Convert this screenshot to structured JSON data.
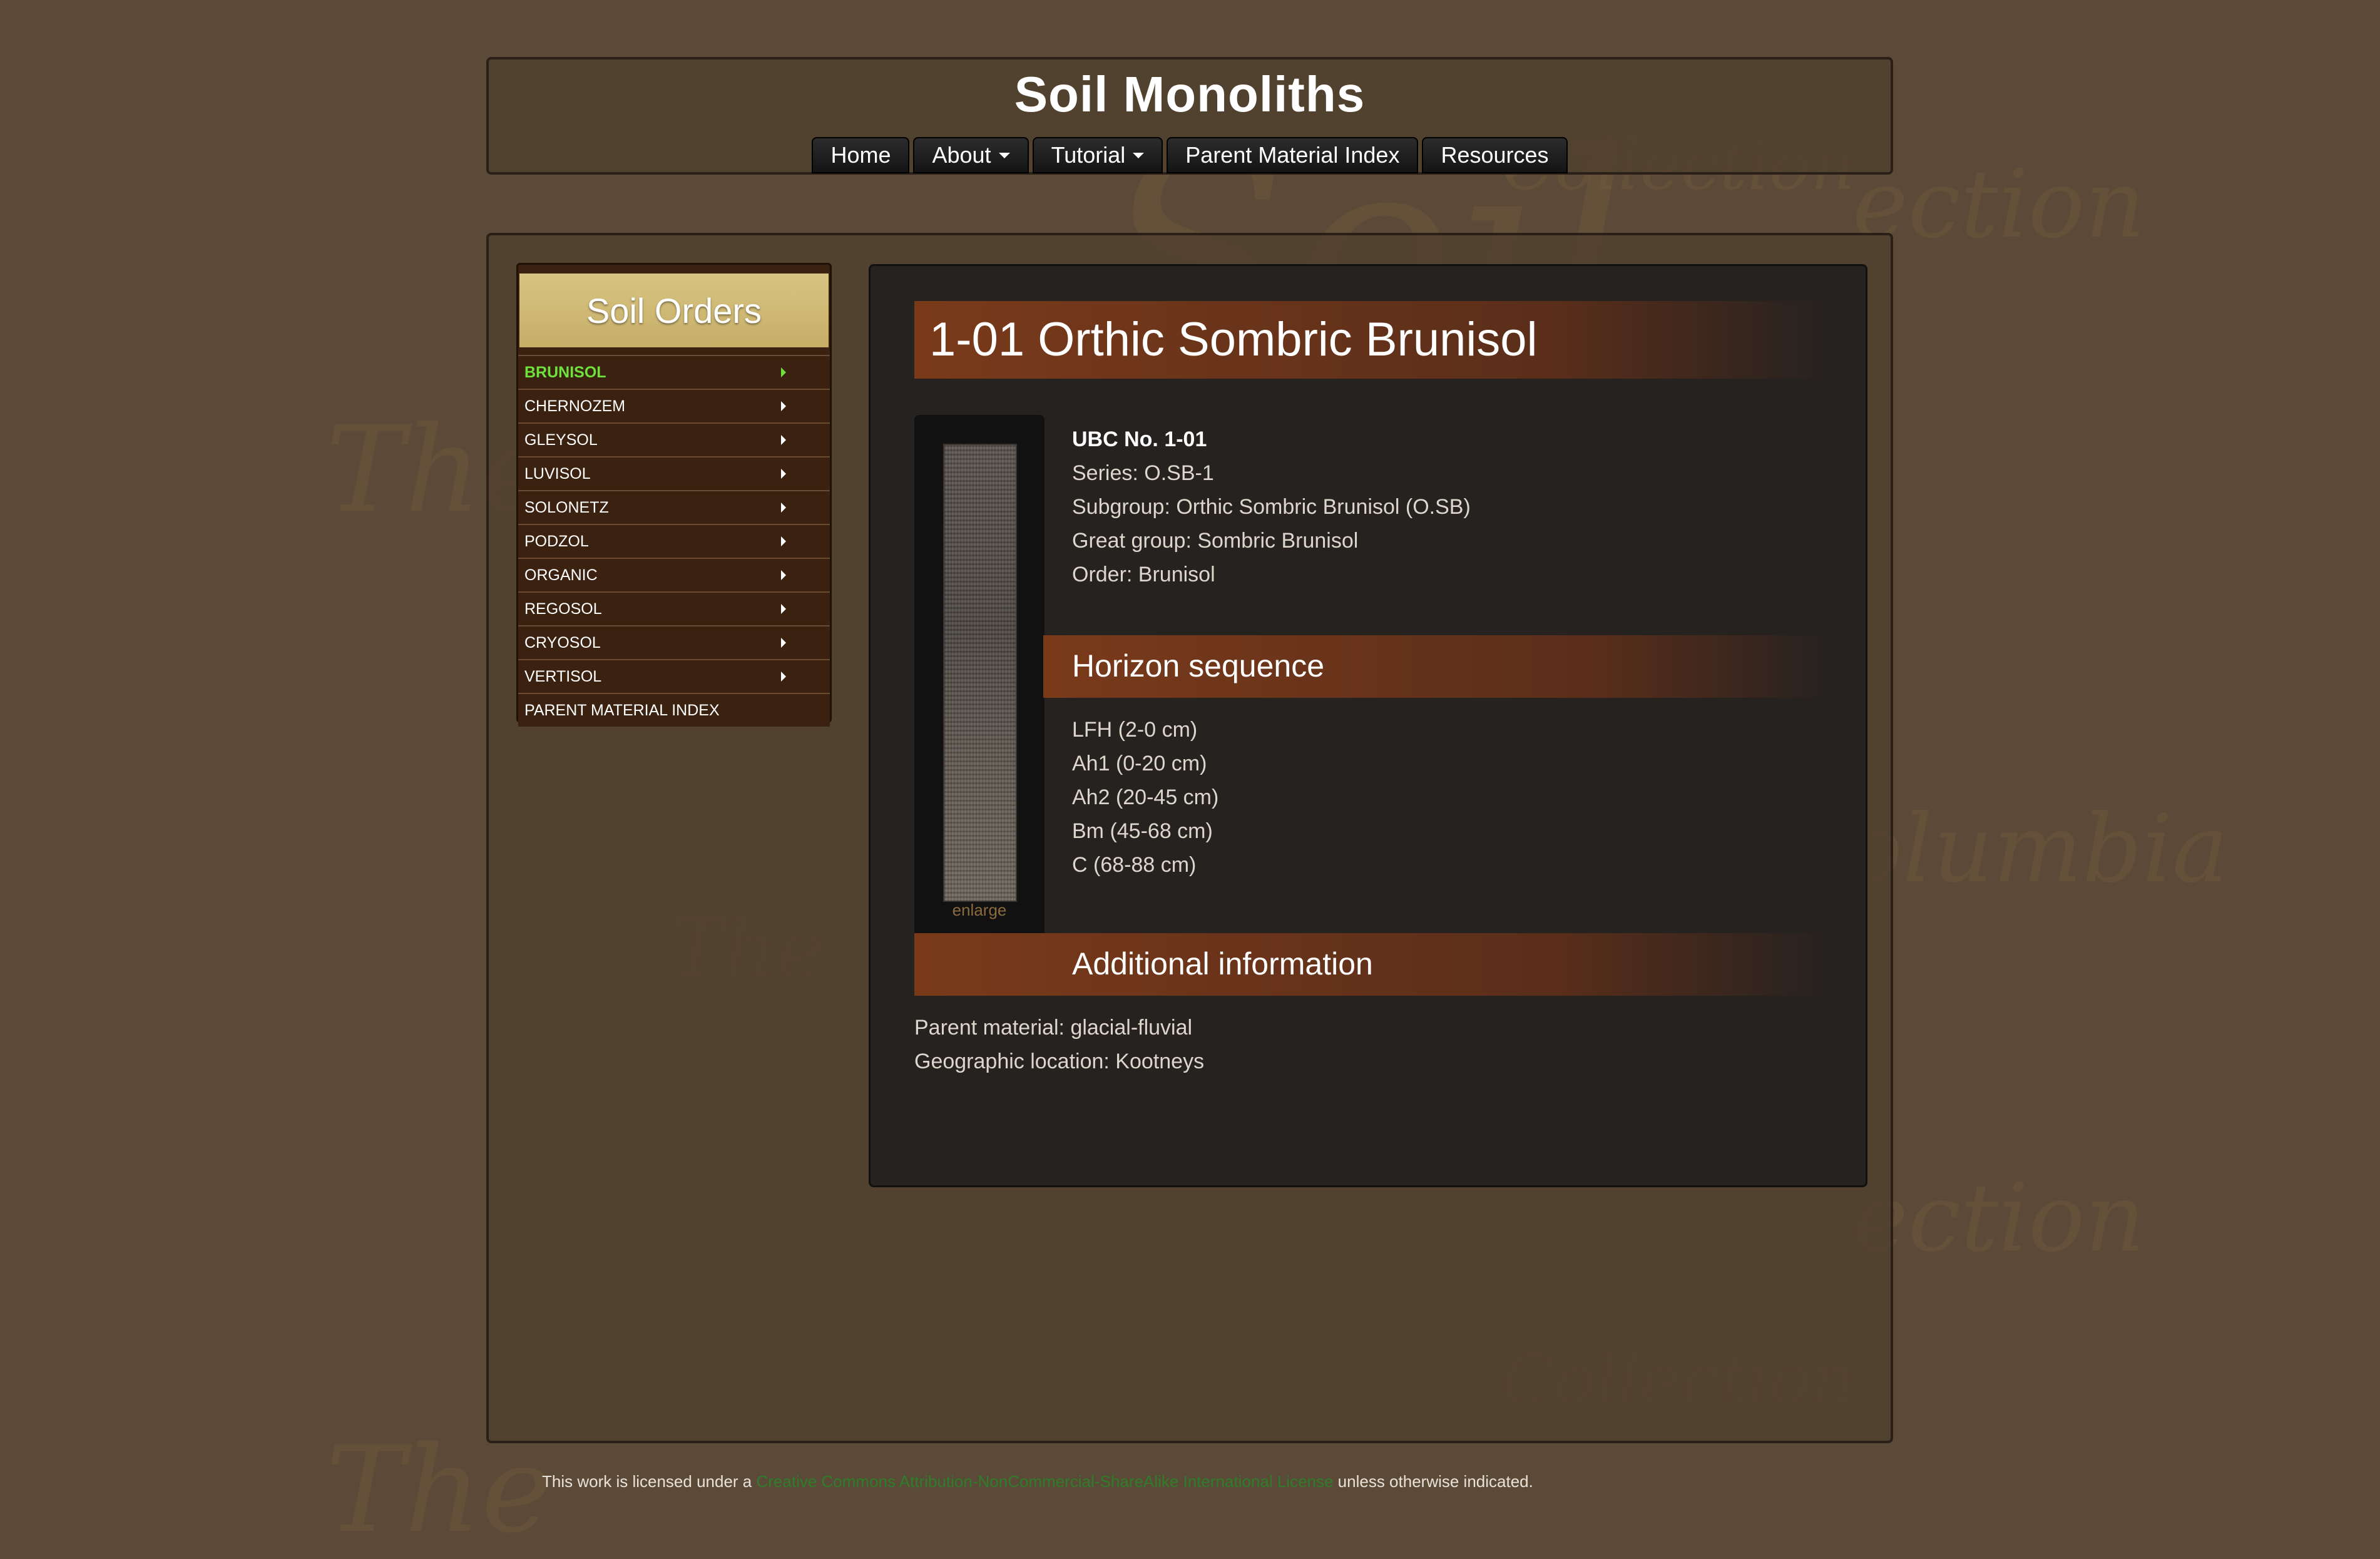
{
  "site": {
    "title": "Soil Monoliths"
  },
  "nav": {
    "items": [
      {
        "label": "Home",
        "dropdown": false
      },
      {
        "label": "About",
        "dropdown": true
      },
      {
        "label": "Tutorial",
        "dropdown": true
      },
      {
        "label": "Parent Material Index",
        "dropdown": false
      },
      {
        "label": "Resources",
        "dropdown": false
      }
    ]
  },
  "sidebar": {
    "heading": "Soil Orders",
    "items": [
      {
        "label": "BRUNISOL",
        "active": true
      },
      {
        "label": "CHERNOZEM"
      },
      {
        "label": "GLEYSOL"
      },
      {
        "label": "LUVISOL"
      },
      {
        "label": "SOLONETZ"
      },
      {
        "label": "PODZOL"
      },
      {
        "label": "ORGANIC"
      },
      {
        "label": "REGOSOL"
      },
      {
        "label": "CRYOSOL"
      },
      {
        "label": "VERTISOL"
      },
      {
        "label": "PARENT MATERIAL INDEX"
      }
    ]
  },
  "monolith": {
    "title": "1-01 Orthic Sombric Brunisol",
    "enlarge": "enlarge",
    "ubc_no": "UBC No. 1-01",
    "series": "Series: O.SB-1",
    "subgroup": "Subgroup: Orthic Sombric Brunisol (O.SB)",
    "great_group": "Great group: Sombric Brunisol",
    "order": "Order: Brunisol",
    "horizon_heading": "Horizon sequence",
    "horizons": [
      "LFH (2-0 cm)",
      "Ah1 (0-20 cm)",
      "Ah2 (20-45 cm)",
      "Bm (45-68 cm)",
      "C (68-88 cm)"
    ],
    "additional_heading": "Additional information",
    "parent_material": "Parent material: glacial-fluvial",
    "location": "Geographic location: Kootneys"
  },
  "footer": {
    "prefix": "This work is licensed under a ",
    "link": "Creative Commons Attribution-NonCommercial-ShareAlike International License",
    "suffix": " unless otherwise indicated."
  },
  "background": {
    "watermark_1": "The",
    "watermark_2": "Soil",
    "watermark_3": "Collection",
    "watermark_4": "olumbia",
    "watermark_5": "ection"
  },
  "colors": {
    "background": "#5b4a38",
    "sidebar_active": "#6ee23a",
    "accent_bar": "#7a3a1a",
    "heading_gold": "#d8c584",
    "license_link": "#2e7d2a"
  }
}
